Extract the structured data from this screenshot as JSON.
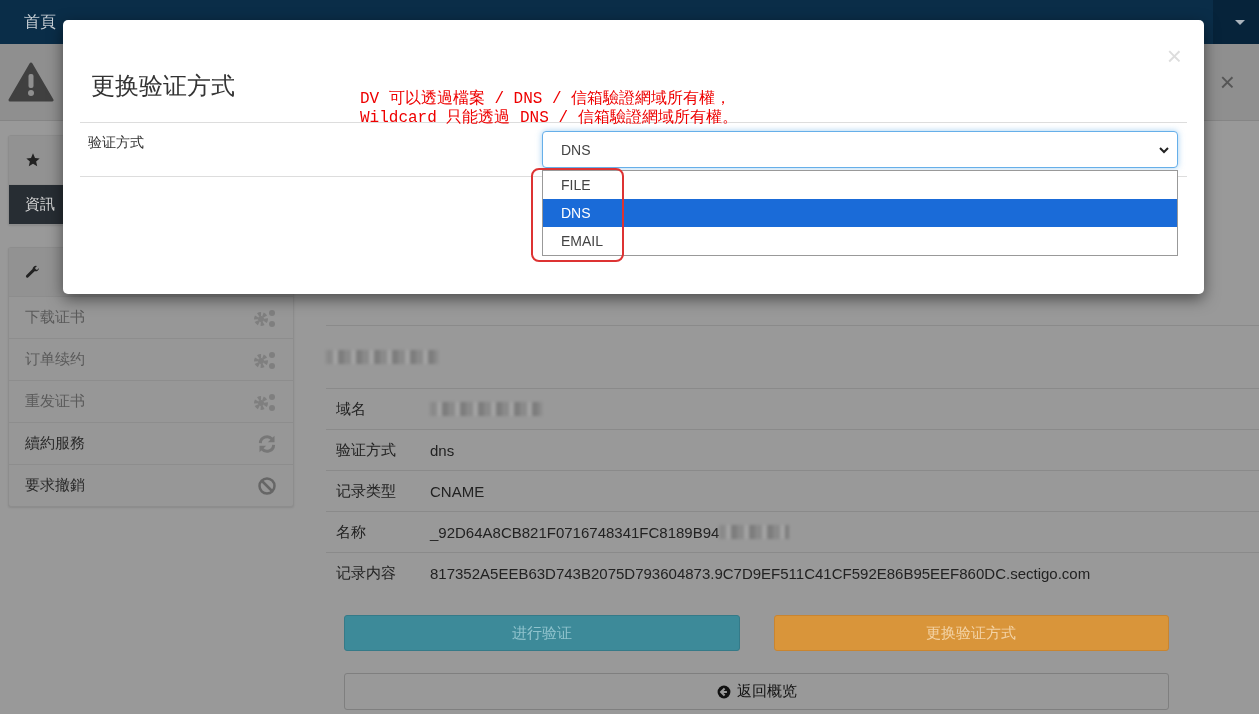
{
  "navbar": {
    "items": [
      {
        "label": "首頁",
        "selected": true
      }
    ]
  },
  "alert": {
    "close": "×"
  },
  "sidebar": {
    "panels": [
      {
        "items": [
          {
            "label": "資訊",
            "selected": true,
            "disabled": false,
            "kind": "plain"
          }
        ]
      },
      {
        "items": [
          {
            "label": "下载证书",
            "selected": false,
            "disabled": true,
            "kind": "gears"
          },
          {
            "label": "订单续约",
            "selected": false,
            "disabled": true,
            "kind": "gears"
          },
          {
            "label": "重发证书",
            "selected": false,
            "disabled": true,
            "kind": "gears"
          },
          {
            "label": "續約服務",
            "selected": false,
            "disabled": false,
            "kind": "refresh"
          },
          {
            "label": "要求撤銷",
            "selected": false,
            "disabled": false,
            "kind": "ban"
          }
        ]
      }
    ]
  },
  "main": {
    "rows": [
      {
        "label": "域名",
        "value": "",
        "kind": "blurred"
      },
      {
        "label": "验证方式",
        "value": "dns",
        "kind": "text"
      },
      {
        "label": "记录类型",
        "value": "CNAME",
        "kind": "text"
      },
      {
        "label": "名称",
        "value": "_92D64A8CB821F0716748341FC8189B94",
        "kind": "partly-blurred"
      },
      {
        "label": "记录内容",
        "value": "817352A5EEB63D743B2075D793604873.9C7D9EF511C41CF592E86B95EEF860DC.sectigo.com",
        "kind": "text"
      }
    ],
    "buttons": [
      {
        "label": "进行验证",
        "kind": "info"
      },
      {
        "label": "更换验证方式",
        "kind": "warning"
      }
    ],
    "back_button": "返回概览"
  },
  "modal": {
    "title": "更换验证方式",
    "close": "×",
    "field_label": "验证方式",
    "select_value": "DNS",
    "options": [
      {
        "label": "FILE",
        "selected": false
      },
      {
        "label": "DNS",
        "selected": true
      },
      {
        "label": "EMAIL",
        "selected": false
      }
    ],
    "annotation": [
      "DV 可以透過檔案 / DNS / 信箱驗證網域所有權，",
      "Wildcard 只能透過 DNS / 信箱驗證網域所有權。"
    ]
  }
}
